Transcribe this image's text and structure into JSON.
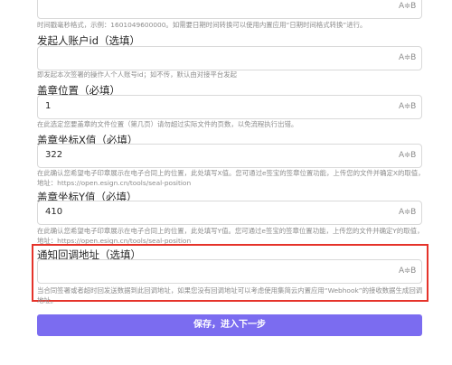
{
  "top_field": {
    "badge": "A≑B",
    "help": "时间戳毫秒格式，示例：1601049600000。如需要日期时间转换可以使用内置应用“日期时间格式转换”进行。"
  },
  "fields": [
    {
      "label": "发起人账户id（选填）",
      "value": "",
      "badge": "A≑B",
      "help": "即发起本次签署的操作人个人账号id；如不传，默认由对接平台发起"
    },
    {
      "label": "盖章位置（必填）",
      "value": "1",
      "badge": "A≑B",
      "help": "在此选定您要盖章的文件位置（第几页）请勿超过实际文件的页数，以免流程执行出错。"
    },
    {
      "label": "盖章坐标X值（必填）",
      "value": "322",
      "badge": "A≑B",
      "help": "在此确认您希望电子印章展示在电子合同上的位置，此处填写X值。您可通过e签宝的签章位置功能，上传您的文件并确定X的取值，地址：https://open.esign.cn/tools/seal-position"
    },
    {
      "label": "盖章坐标Y值（必填）",
      "value": "410",
      "badge": "A≑B",
      "help": "在此确认您希望电子印章展示在电子合同上的位置，此处填写Y值。您可通过e签宝的签章位置功能，上传您的文件并确定Y的取值，地址：https://open.esign.cn/tools/seal-position"
    },
    {
      "label": "通知回调地址（选填）",
      "value": "",
      "badge": "A≑B",
      "help": "当合同签署或者超时回发送数据到此回调地址，如果您没有回调地址可以考虑使用集简云内置应用“Webhook”的接收数据生成回调地址。"
    }
  ],
  "submit_label": "保存，进入下一步"
}
